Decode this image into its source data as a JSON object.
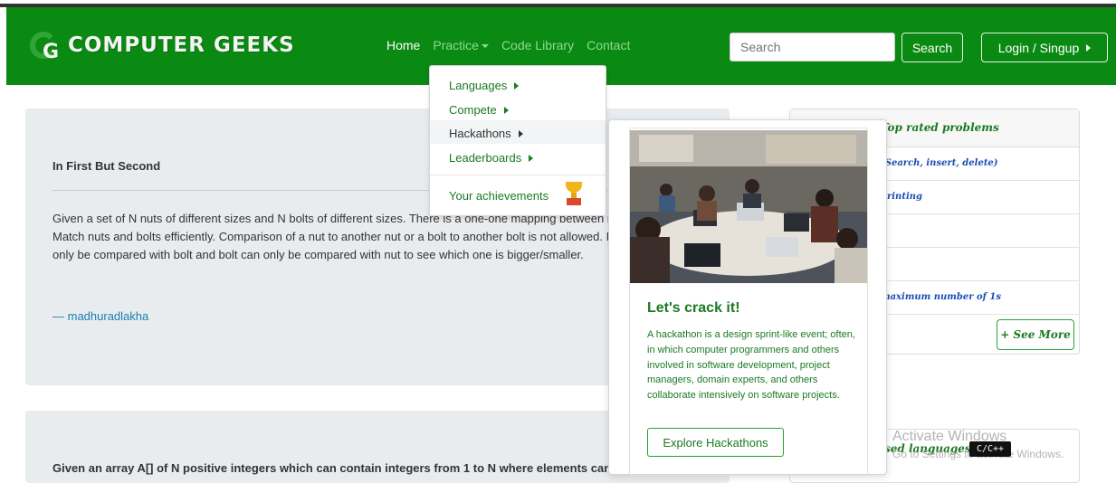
{
  "brand": {
    "logo_letter": "G",
    "name": "COMPUTER GEEKS"
  },
  "nav": {
    "home": "Home",
    "practice": "Practice",
    "code_library": "Code Library",
    "contact": "Contact"
  },
  "search": {
    "placeholder": "Search",
    "button": "Search"
  },
  "login": {
    "label": "Login / Singup"
  },
  "practice_menu": {
    "items": [
      "Languages",
      "Compete",
      "Hackathons",
      "Leaderboards"
    ],
    "achievements": "Your achievements"
  },
  "hackathon_card": {
    "title": "Let's crack it!",
    "description": "A hackathon is a design sprint-like event; often, in which computer programmers and others involved in software development, project managers, domain experts, and others collaborate intensively on software projects.",
    "button": "Explore Hackathons"
  },
  "problems": [
    {
      "title": "In First But Second",
      "body": "Given a set of N nuts of different sizes and N bolts of different sizes. There is a one-one mapping between nuts and bolts. Match nuts and bolts efficiently. Comparison of a nut to another nut or a bolt to another bolt is not allowed. It means nut can only be compared with bolt and bolt can only be compared with nut to see which one is bigger/smaller.",
      "author": "— madhuradlakha"
    },
    {
      "body": "Given an array A[] of N positive integers which can contain integers from 1 to N where elements can be repeated or can be absent from the array."
    }
  ],
  "sidebar": {
    "top_rated_title": "Top rated problems",
    "rows": [
      "(Search, insert, delete)",
      "printing",
      "",
      "",
      "maximum number of 1s"
    ],
    "see_more": "+ See More",
    "languages_title": "sed languages",
    "language_badge": "C/C++"
  },
  "windows_watermark": {
    "title": "Activate Windows",
    "subtitle": "Go to Settings to activate Windows."
  },
  "colors": {
    "navbar": "#0a8a12",
    "accent": "#1b7a22",
    "card_bg": "#e9ecef"
  }
}
